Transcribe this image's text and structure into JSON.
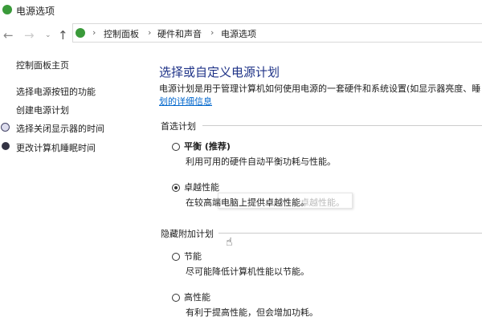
{
  "window": {
    "title": "电源选项"
  },
  "breadcrumb": [
    "控制面板",
    "硬件和声音",
    "电源选项"
  ],
  "sidebar": {
    "items": [
      "控制面板主页",
      "选择电源按钮的功能",
      "创建电源计划",
      "选择关闭显示器的时间",
      "更改计算机睡眠时间"
    ]
  },
  "main": {
    "heading": "选择或自定义电源计划",
    "description": "电源计划是用于管理计算机如何使用电源的一套硬件和系统设置(如显示器亮度、睡",
    "link": "划的详细信息",
    "preferred_label": "首选计划",
    "hidden_label": "隐藏附加计划",
    "plans": [
      {
        "name": "平衡 (推荐)",
        "desc": "利用可用的硬件自动平衡功耗与性能。",
        "selected": false
      },
      {
        "name": "卓越性能",
        "desc": "在较高端电脑上提供卓越性能。",
        "selected": true
      },
      {
        "name": "节能",
        "desc": "尽可能降低计算机性能以节能。",
        "selected": false
      },
      {
        "name": "高性能",
        "desc": "有利于提高性能，但会增加功耗。",
        "selected": false
      }
    ],
    "tooltip": "卓越性能。"
  }
}
